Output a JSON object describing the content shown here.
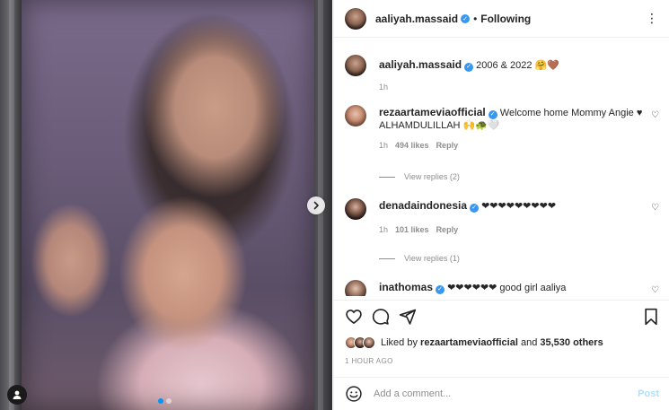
{
  "post": {
    "author": "aaliyah.massaid",
    "follow_status": "Following",
    "carousel_dots": 2,
    "carousel_active": 0
  },
  "caption": {
    "username": "aaliyah.massaid",
    "text": "2006 & 2022 🤗🤎",
    "time": "1h"
  },
  "comments": [
    {
      "username": "rezaartameviaofficial",
      "text": "Welcome home Mommy Angie ♥ ALHAMDULILLAH 🙌🐢🤍",
      "time": "1h",
      "likes": "494 likes",
      "reply": "Reply",
      "view_replies": "View replies (2)"
    },
    {
      "username": "denadaindonesia",
      "text": "❤❤❤❤❤❤❤❤❤",
      "time": "1h",
      "likes": "101 likes",
      "reply": "Reply",
      "view_replies": "View replies (1)"
    },
    {
      "username": "inathomas",
      "text": "❤❤❤❤❤❤ good girl aaliya"
    }
  ],
  "liked_by": {
    "prefix": "Liked by",
    "user": "rezaartameviaofficial",
    "middle": "and",
    "others": "35,530 others"
  },
  "timestamp": "1 HOUR AGO",
  "add_comment": {
    "placeholder": "Add a comment...",
    "post_label": "Post"
  },
  "colors": {
    "accent": "#0095f6",
    "verified": "#3897f0",
    "post_disabled": "#b2dffc",
    "heart_red": "#e0245e"
  }
}
